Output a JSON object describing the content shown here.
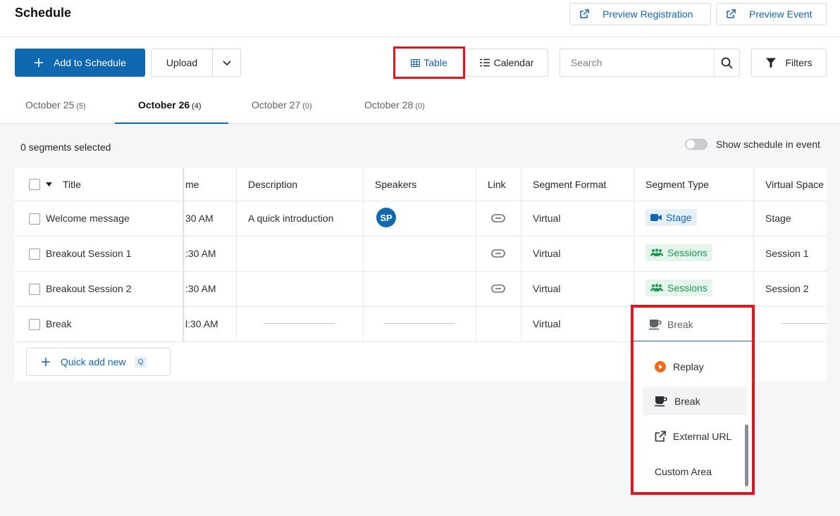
{
  "header": {
    "title": "Schedule",
    "preview_registration": "Preview Registration",
    "preview_event": "Preview Event"
  },
  "toolbar": {
    "add_label": "Add to Schedule",
    "upload_label": "Upload",
    "table_label": "Table",
    "calendar_label": "Calendar",
    "search_placeholder": "Search",
    "filters_label": "Filters"
  },
  "tabs": [
    {
      "label": "October 25",
      "count": "(5)"
    },
    {
      "label": "October 26",
      "count": "(4)"
    },
    {
      "label": "October 27",
      "count": "(0)"
    },
    {
      "label": "October 28",
      "count": "(0)"
    }
  ],
  "selection": {
    "selected_text": "0 segments selected",
    "toggle_label": "Show schedule in event"
  },
  "table": {
    "columns": [
      "Title",
      "me",
      "Description",
      "Speakers",
      "Link",
      "Segment Format",
      "Segment Type",
      "Virtual Space"
    ],
    "rows": [
      {
        "title": "Welcome message",
        "time": "30 AM",
        "description": "A quick introduction",
        "speaker": "SP",
        "format": "Virtual",
        "type": "Stage",
        "space": "Stage"
      },
      {
        "title": "Breakout Session 1",
        "time": ":30 AM",
        "description": "",
        "speaker": "",
        "format": "Virtual",
        "type": "Sessions",
        "space": "Session 1"
      },
      {
        "title": "Breakout Session 2",
        "time": ":30 AM",
        "description": "",
        "speaker": "",
        "format": "Virtual",
        "type": "Sessions",
        "space": "Session 2"
      },
      {
        "title": "Break",
        "time": "l:30 AM",
        "description": "",
        "speaker": "",
        "format": "Virtual",
        "type": "Break",
        "space": ""
      }
    ],
    "quick_add": "Quick add new",
    "quick_add_key": "Q"
  },
  "dropdown": {
    "current": "Break",
    "options": [
      "Replay",
      "Break",
      "External URL",
      "Custom Area"
    ]
  },
  "colors": {
    "primary": "#0f68b0",
    "highlight": "#e1151c",
    "sessions_green": "#1b9b52"
  }
}
